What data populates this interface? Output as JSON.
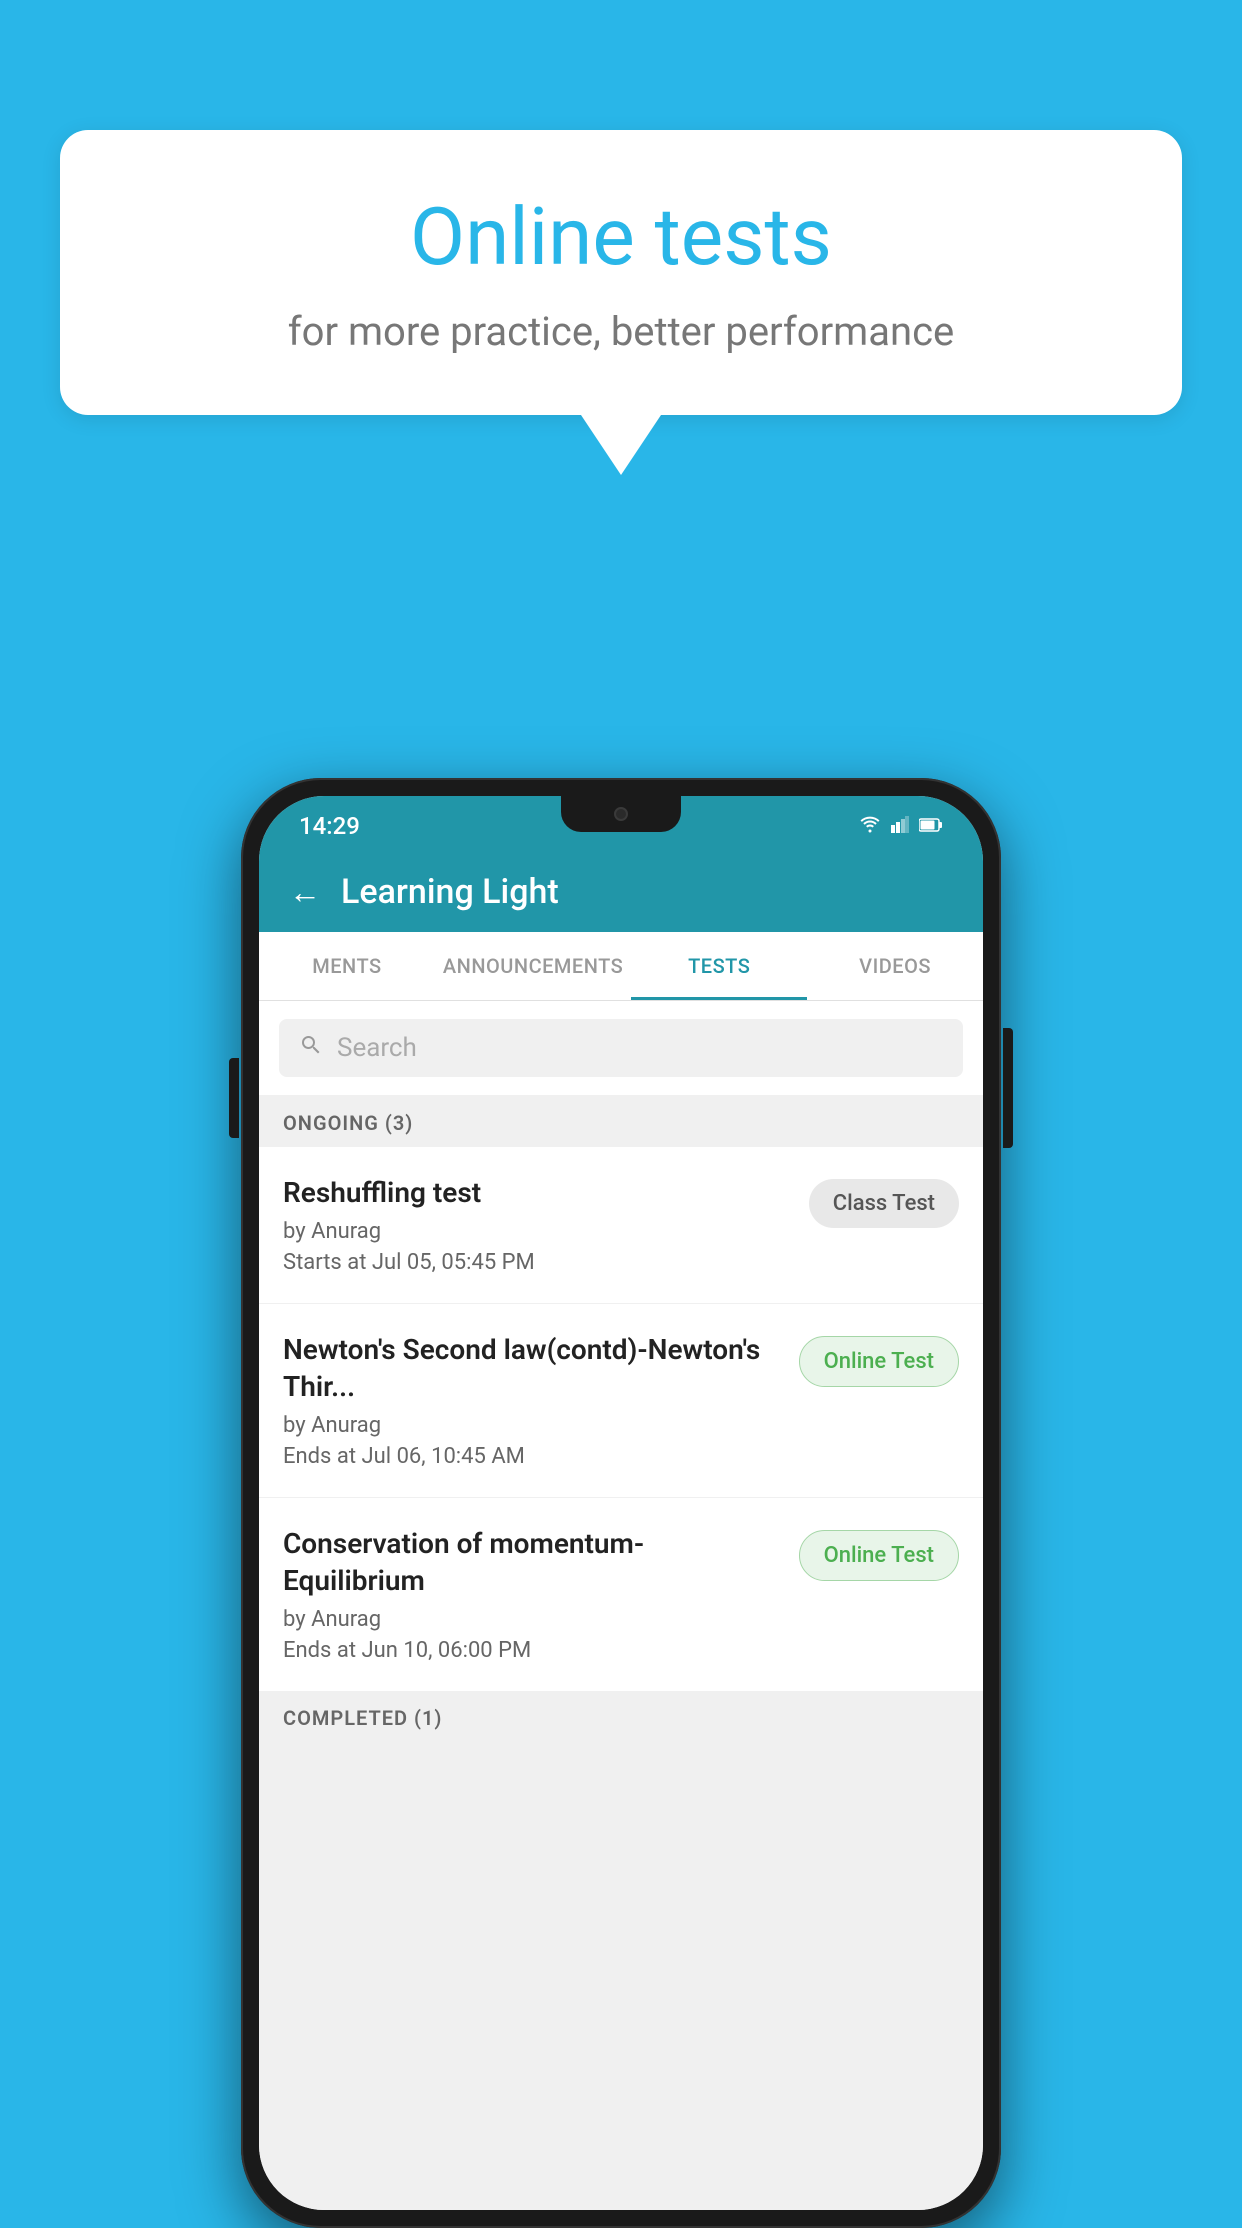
{
  "background_color": "#29b6e8",
  "speech_bubble": {
    "title": "Online tests",
    "subtitle": "for more practice, better performance"
  },
  "status_bar": {
    "time": "14:29",
    "wifi": "▼",
    "signal": "▲",
    "battery": "▌"
  },
  "header": {
    "title": "Learning Light",
    "back_label": "←"
  },
  "tabs": [
    {
      "label": "MENTS",
      "active": false
    },
    {
      "label": "ANNOUNCEMENTS",
      "active": false
    },
    {
      "label": "TESTS",
      "active": true
    },
    {
      "label": "VIDEOS",
      "active": false
    }
  ],
  "search": {
    "placeholder": "Search"
  },
  "ongoing_section": {
    "label": "ONGOING (3)"
  },
  "test_items": [
    {
      "title": "Reshuffling test",
      "author": "by Anurag",
      "date": "Starts at  Jul 05, 05:45 PM",
      "badge": "Class Test",
      "badge_type": "class"
    },
    {
      "title": "Newton's Second law(contd)-Newton's Thir...",
      "author": "by Anurag",
      "date": "Ends at  Jul 06, 10:45 AM",
      "badge": "Online Test",
      "badge_type": "online"
    },
    {
      "title": "Conservation of momentum-Equilibrium",
      "author": "by Anurag",
      "date": "Ends at  Jun 10, 06:00 PM",
      "badge": "Online Test",
      "badge_type": "online"
    }
  ],
  "completed_section": {
    "label": "COMPLETED (1)"
  }
}
